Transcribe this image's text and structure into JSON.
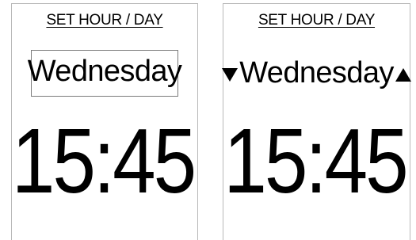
{
  "panels": [
    {
      "title": "SET HOUR / DAY",
      "day": "Wednesday",
      "time": "15:45",
      "mode": "day-selected-boxed"
    },
    {
      "title": "SET HOUR / DAY",
      "day": "Wednesday",
      "time": "15:45",
      "mode": "day-adjust-arrows",
      "icons": [
        "arrow-down-icon",
        "arrow-up-icon"
      ]
    }
  ]
}
